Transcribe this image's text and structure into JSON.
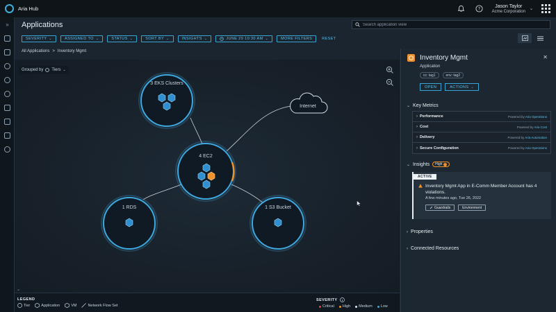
{
  "topbar": {
    "app_name": "Aria Hub",
    "user_name": "Jason Taylor",
    "user_org": "Acme Corporation",
    "icons": [
      "bell-icon",
      "help-icon",
      "app-grid-icon"
    ]
  },
  "rail": {
    "items": [
      "expand-icon",
      "home-icon",
      "map-icon",
      "cloud-icon",
      "globe-icon",
      "clock-icon",
      "server-icon",
      "shield-icon",
      "truck-icon",
      "target-icon"
    ]
  },
  "page": {
    "title": "Applications"
  },
  "search": {
    "placeholder": "Search application view"
  },
  "filters": {
    "chips": [
      "SEVERITY",
      "ASSIGNED TO",
      "STATUS",
      "SORT BY",
      "INSIGHTS"
    ],
    "date": "JUNE 29 10:30 AM",
    "more": "MORE FILTERS",
    "reset": "RESET"
  },
  "breadcrumb": {
    "root": "All Applications",
    "separator": ">",
    "current": "Inventory Mgmt"
  },
  "canvas": {
    "grouped_by_label": "Grouped by",
    "grouped_by_value": "Tiers",
    "nodes": {
      "eks": "3 EKS Clusters",
      "ec2": "4 EC2",
      "rds": "1 RDS",
      "s3": "1 S3 Bucket",
      "internet": "Internet"
    }
  },
  "legend": {
    "title": "LEGEND",
    "items": [
      "Tier",
      "Application",
      "VM",
      "Network Flow Set"
    ],
    "severity_title": "SEVERITY",
    "severity": [
      {
        "label": "Critical",
        "color": "#e0453a"
      },
      {
        "label": "High",
        "color": "#f0922b"
      },
      {
        "label": "Medium",
        "color": "#e6edf3"
      },
      {
        "label": "Low",
        "color": "#3fa9e0"
      }
    ]
  },
  "panel": {
    "title": "Inventory Mgmt",
    "subtitle": "Application",
    "tags": [
      "cc: tag1",
      "env: tag2"
    ],
    "open": "OPEN",
    "actions": "ACTIONS",
    "key_metrics": "Key Metrics",
    "metrics": [
      {
        "name": "Performance",
        "by_prefix": "Powered by",
        "by": "Aria Operations"
      },
      {
        "name": "Cost",
        "by_prefix": "Powered by",
        "by": "Aria Cost"
      },
      {
        "name": "Delivery",
        "by_prefix": "Powered by",
        "by": "Aria Automation"
      },
      {
        "name": "Secure Configuration",
        "by_prefix": "Powered by",
        "by": "Aria Operations"
      }
    ],
    "insights": "Insights",
    "insights_level": "High",
    "insight": {
      "status": "ACTIVE",
      "text": "Inventory Mgmt App in E-Comm Member Account has 4 violations.",
      "time": "A few minutes ago, Tue 26, 2022",
      "btn1": "Guardrails",
      "btn2": "Environment"
    },
    "properties": "Properties",
    "connected": "Connected Resources"
  },
  "colors": {
    "accent": "#3aa6d3",
    "high": "#f0922b",
    "node_ring": "#3fa9e0"
  }
}
